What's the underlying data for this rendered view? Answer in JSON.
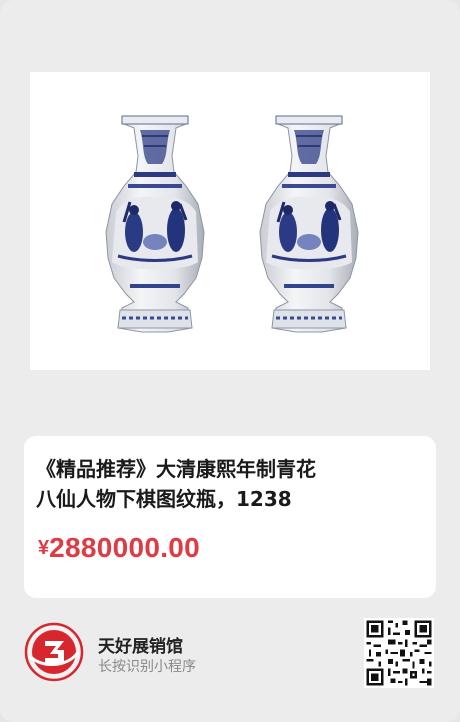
{
  "product": {
    "image_icon": "blue-white-vase-pair-image",
    "title": "《精品推荐》大清康熙年制青花\n八仙人物下棋图纹瓶，1238",
    "price_symbol": "¥",
    "price": "2880000.00"
  },
  "shop": {
    "logo_icon": "red-circle-logo",
    "name": "天好展销馆",
    "hint": "长按识别小程序",
    "qr_icon": "qr-code-icon"
  },
  "colors": {
    "price": "#e03a43",
    "background": "#ececec",
    "logo_red": "#d8262e"
  }
}
